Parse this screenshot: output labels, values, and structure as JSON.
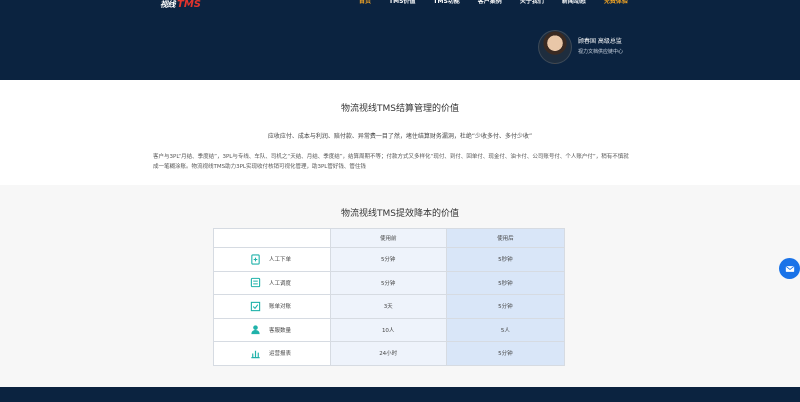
{
  "header": {
    "logo_mark": "视线",
    "logo_tms": "TMS",
    "nav": [
      "首页",
      "TMS价值",
      "TMS功能",
      "客户案例",
      "关于我们",
      "新闻动态",
      "免费体验"
    ],
    "nav_active_index": 0,
    "profile": {
      "name": "顾春国 高级总监",
      "title": "视力文档供应链中心"
    }
  },
  "section1": {
    "title": "物流视线TMS结算管理的价值",
    "lead": "应收应付、成本与利润、赔付款、异常费一目了然，堵住结算财务漏洞，杜绝“少收多付、多付少收”",
    "body": "客户与3PL“月结、季度结”，3PL与专线、车队、司机之“天结、月结、季度结”，结算周期不等；付款方式又多样化“现付、到付、回单付、现金付、油卡付、公司账号付、个人账户付”，稍有不慎就成一笔糊涂账。物流视线TMS助力3PL实现收付核销可视化管理，助3PL管好钱、管住钱"
  },
  "section2": {
    "title": "物流视线TMS提效降本的价值",
    "headers": [
      "",
      "使用前",
      "使用后"
    ],
    "rows": [
      {
        "icon": "order-icon",
        "label": "人工下单",
        "before": "5分钟",
        "after": "5秒钟"
      },
      {
        "icon": "dispatch-icon",
        "label": "人工调度",
        "before": "5分钟",
        "after": "5秒钟"
      },
      {
        "icon": "reconcile-icon",
        "label": "账单对账",
        "before": "3天",
        "after": "5分钟"
      },
      {
        "icon": "service-icon",
        "label": "客服数量",
        "before": "10人",
        "after": "5人"
      },
      {
        "icon": "report-icon",
        "label": "运营报表",
        "before": "24小时",
        "after": "5分钟"
      }
    ]
  },
  "float": {
    "icon": "mail-icon"
  },
  "colors": {
    "header_bg": "#0b2340",
    "accent": "#20b2aa",
    "active_nav": "#f5a623",
    "after_col": "#d9e6f8"
  }
}
